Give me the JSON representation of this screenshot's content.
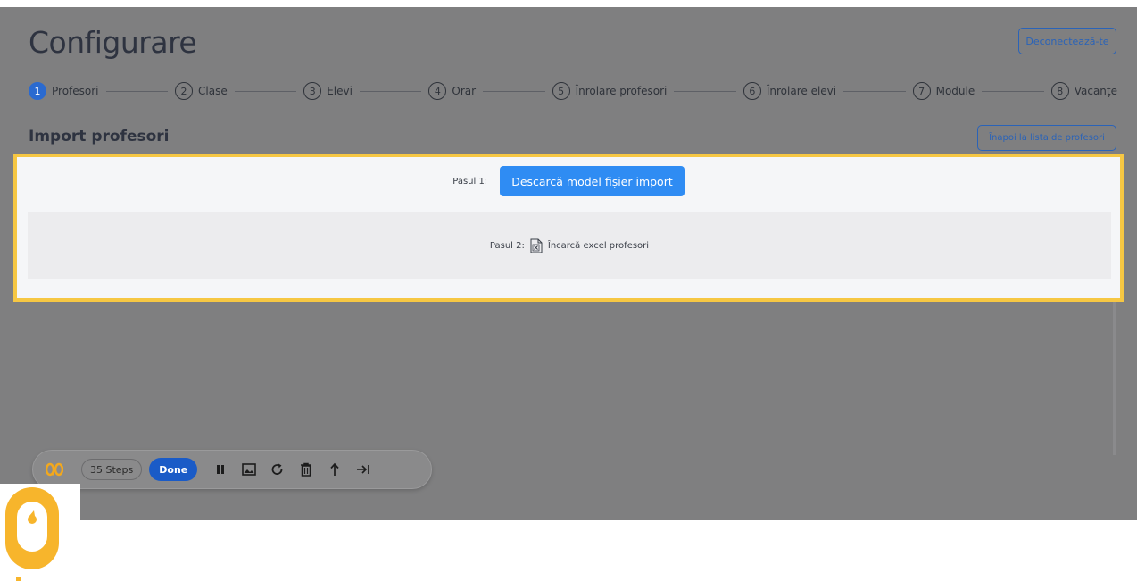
{
  "page": {
    "title": "Configurare",
    "logout_label": "Deconectează-te"
  },
  "stepper": {
    "steps": [
      {
        "number": "1",
        "label": "Profesori"
      },
      {
        "number": "2",
        "label": "Clase"
      },
      {
        "number": "3",
        "label": "Elevi"
      },
      {
        "number": "4",
        "label": "Orar"
      },
      {
        "number": "5",
        "label": "Înrolare profesori"
      },
      {
        "number": "6",
        "label": "Înrolare elevi"
      },
      {
        "number": "7",
        "label": "Module"
      },
      {
        "number": "8",
        "label": "Vacanțe"
      }
    ],
    "active_step": 1
  },
  "section": {
    "title": "Import profesori",
    "back_label": "Înapoi la lista de profesori"
  },
  "import": {
    "step1_label": "Pasul 1:",
    "download_label": "Descarcă model fișier import",
    "step2_label": "Pasul 2:",
    "upload_label": "Încarcă excel profesori",
    "upload_icon": "excel-file-icon"
  },
  "toolbar": {
    "steps_count": "35 Steps",
    "done_label": "Done",
    "icons": [
      "pause-icon",
      "image-icon",
      "redo-icon",
      "trash-icon",
      "share-icon",
      "skip-icon"
    ]
  },
  "colors": {
    "accent": "#2f8cf3",
    "highlight_border": "#f6c743",
    "done_button": "#1a5bc7",
    "brand": "#f7b52c"
  }
}
